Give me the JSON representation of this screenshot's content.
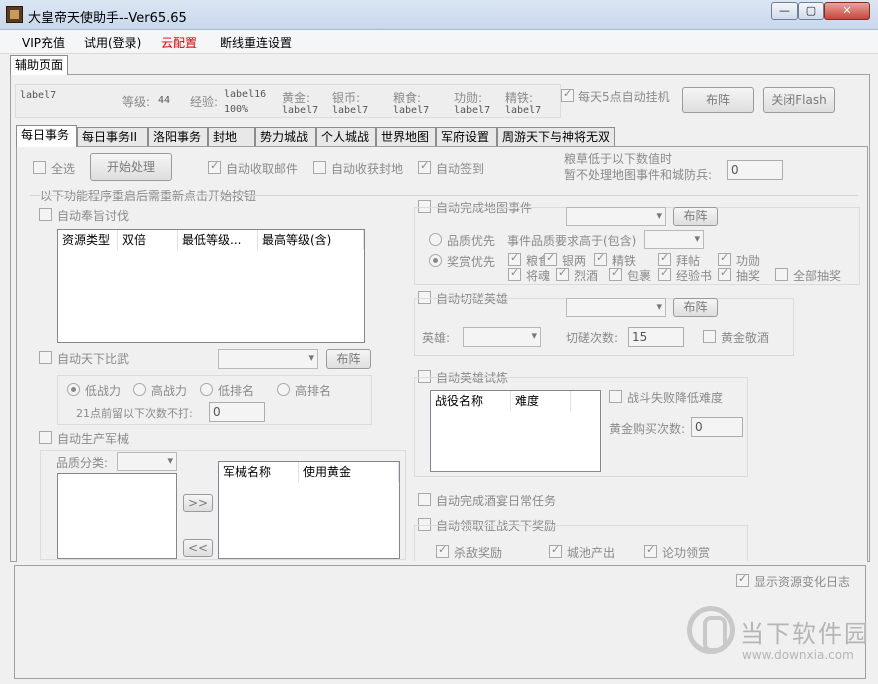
{
  "window": {
    "title": "大皇帝天使助手--Ver65.65",
    "min_glyph": "—",
    "max_glyph": "▢",
    "close_glyph": "✕"
  },
  "menu": [
    "VIP充值",
    "试用(登录)",
    "云配置",
    "断线重连设置"
  ],
  "menu_highlight_color": "#e00000",
  "top_tab": "辅助页面",
  "info": {
    "name_value": "label7",
    "level_label": "等级:",
    "level_value": "44",
    "exp_label": "经验:",
    "exp_value": "label16",
    "exp_percent": "100%",
    "gold_label": "黄金:",
    "gold_value": "label7",
    "silver_label": "银币:",
    "silver_value": "label7",
    "food_label": "粮食:",
    "food_value": "label7",
    "merit_label": "功勋:",
    "merit_value": "label7",
    "iron_label": "精铁:",
    "iron_value": "label7",
    "auto_hang_label": "每天5点自动挂机",
    "arrange_button": "布阵",
    "close_flash_button": "关闭Flash"
  },
  "tabs": [
    "每日事务",
    "每日事务II",
    "洛阳事务",
    "封地",
    "势力城战",
    "个人城战",
    "世界地图",
    "军府设置",
    "周游天下与神将无双"
  ],
  "daily": {
    "select_all": "全选",
    "start_button": "开始处理",
    "auto_mail": "自动收取邮件",
    "auto_fief": "自动收获封地",
    "auto_signin": "自动签到",
    "grain_note_1": "粮草低于以下数值时",
    "grain_note_2": "暂不处理地图事件和城防兵:",
    "grain_value": "0",
    "restart_note": "以下功能程序重启后需重新点击开始按钮",
    "auto_edict": "自动奉旨讨伐",
    "edict_columns": [
      "资源类型",
      "双倍",
      "最低等级...",
      "最高等级(含)"
    ],
    "auto_tournament": "自动天下比武",
    "tournament_arrange": "布阵",
    "power_options": [
      "低战力",
      "高战力",
      "低排名",
      "高排名"
    ],
    "no_fight_label": "21点前留以下次数不打:",
    "no_fight_value": "0",
    "auto_weapon": "自动生产军械",
    "quality_label": "品质分类:",
    "move_right": ">>",
    "move_left": "<<",
    "weapon_columns": [
      "军械名称",
      "使用黄金"
    ],
    "auto_map_event": "自动完成地图事件",
    "map_arrange": "布阵",
    "quality_first": "品质优先",
    "event_quality_label": "事件品质要求高于(包含)",
    "reward_first": "奖赏优先",
    "rewards_row1": [
      "粮食",
      "银两",
      "精铁",
      "拜帖",
      "功勋"
    ],
    "rewards_row2": [
      "将魂",
      "烈酒",
      "包裹",
      "经验书",
      "抽奖"
    ],
    "all_lottery": "全部抽奖",
    "auto_spar": "自动切磋英雄",
    "spar_arrange": "布阵",
    "hero_label": "英雄:",
    "spar_count_label": "切磋次数:",
    "spar_count_value": "15",
    "gold_wine": "黄金敬酒",
    "auto_trial": "自动英雄试炼",
    "trial_columns": [
      "战役名称",
      "难度"
    ],
    "lose_lower": "战斗失败降低难度",
    "gold_buy_label": "黄金购买次数:",
    "gold_buy_value": "0",
    "auto_feast": "自动完成酒宴日常任务",
    "auto_campaign": "自动领取征战天下奖励",
    "campaign_rewards": [
      "杀敌奖励",
      "城池产出",
      "论功领赏"
    ]
  },
  "log": {
    "show_changes": "显示资源变化日志"
  },
  "watermark": {
    "title": "当下软件园",
    "url": "www.downxia.com"
  }
}
